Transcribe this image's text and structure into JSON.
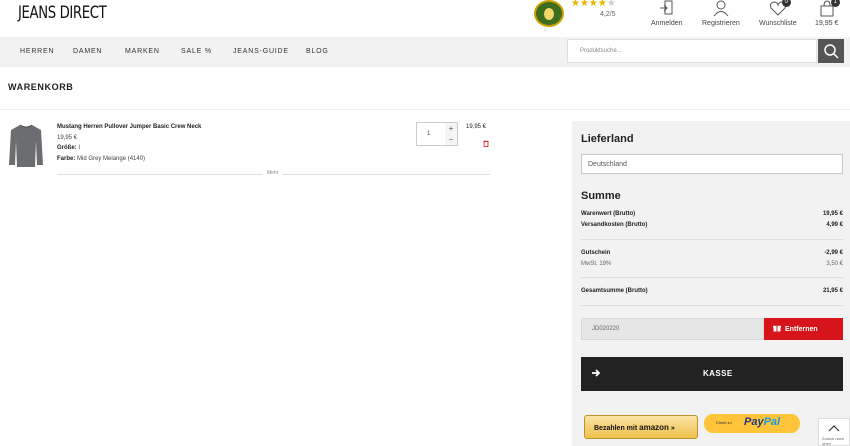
{
  "header": {
    "logo": "JEANS DIRECT",
    "rating": {
      "stars_filled": 4,
      "stars_total": 5,
      "text": "4,2/5"
    },
    "icons": [
      {
        "label": "Anmelden",
        "icon": "login-icon"
      },
      {
        "label": "Registrieren",
        "icon": "user-icon"
      },
      {
        "label": "Wunschliste",
        "icon": "heart-icon",
        "count": "0"
      },
      {
        "label": "19,95 €",
        "icon": "bag-icon",
        "count": "1"
      }
    ]
  },
  "nav": {
    "items": [
      "HERREN",
      "DAMEN",
      "MARKEN",
      "SALE %",
      "JEANS-GUIDE",
      "BLOG"
    ],
    "search_placeholder": "Produktsuche..."
  },
  "page_title": "WARENKORB",
  "cart_item": {
    "name": "Mustang Herren Pullover Jumper Basic Crew Neck",
    "price": "19,95 €",
    "size_label": "Größe:",
    "size_value": "I",
    "color_label": "Farbe:",
    "color_value": "Mid Grey Melange (4140)",
    "more": "Mehr",
    "quantity": "1",
    "line_total": "19,95 €"
  },
  "summary": {
    "country_heading": "Lieferland",
    "country_value": "Deutschland",
    "sum_heading": "Summe",
    "rows": [
      {
        "label": "Warenwert (Brutto)",
        "value": "19,95 €"
      },
      {
        "label": "Versandkosten (Brutto)",
        "value": "4,99 €"
      },
      {
        "label": "Gutschein",
        "value": "-2,99 €"
      },
      {
        "label": "MwSt. 19%",
        "value": "3,50 €"
      },
      {
        "label": "Gesamtsumme (Brutto)",
        "value": "21,95 €"
      }
    ],
    "coupon_code": "JD020220",
    "remove_label": "Entfernen",
    "checkout_label": "KASSE",
    "amazon_label": "Bezahlen mit",
    "amazon_brand": "amazon",
    "paypal_small": "Direkt zu",
    "paypal_brand_1": "Pay",
    "paypal_brand_2": "Pal",
    "to_top": "Zurück nach oben"
  },
  "colors": {
    "accent_red": "#d7141a",
    "checkout_dark": "#222222",
    "amazon_yellow": "#f0c14b",
    "paypal_yellow": "#ffc439",
    "star": "#e7b400"
  }
}
